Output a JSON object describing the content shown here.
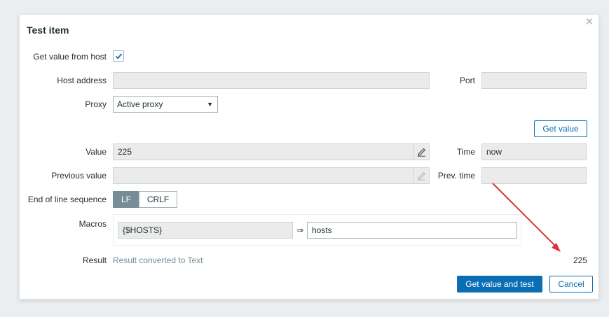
{
  "dialog": {
    "title": "Test item",
    "close_icon": "close-icon"
  },
  "form": {
    "get_value_from_host": {
      "label": "Get value from host",
      "checked": true
    },
    "host_address": {
      "label": "Host address",
      "value": ""
    },
    "port": {
      "label": "Port",
      "value": ""
    },
    "proxy": {
      "label": "Proxy",
      "selected": "Active proxy"
    },
    "get_value_button": "Get value",
    "value": {
      "label": "Value",
      "value": "225"
    },
    "time": {
      "label": "Time",
      "value": "now"
    },
    "previous_value": {
      "label": "Previous value",
      "value": ""
    },
    "prev_time": {
      "label": "Prev. time",
      "value": ""
    },
    "eol": {
      "label": "End of line sequence",
      "options": [
        "LF",
        "CRLF"
      ],
      "selected": "LF"
    },
    "macros": {
      "label": "Macros",
      "rows": [
        {
          "macro": "{$HOSTS}",
          "arrow": "⇒",
          "value": "hosts"
        }
      ]
    },
    "result": {
      "label": "Result",
      "note": "Result converted to Text",
      "value": "225"
    }
  },
  "footer": {
    "test_button": "Get value and test",
    "cancel_button": "Cancel"
  },
  "colors": {
    "accent": "#0a6eb4",
    "annotation_arrow": "#e0303a"
  }
}
